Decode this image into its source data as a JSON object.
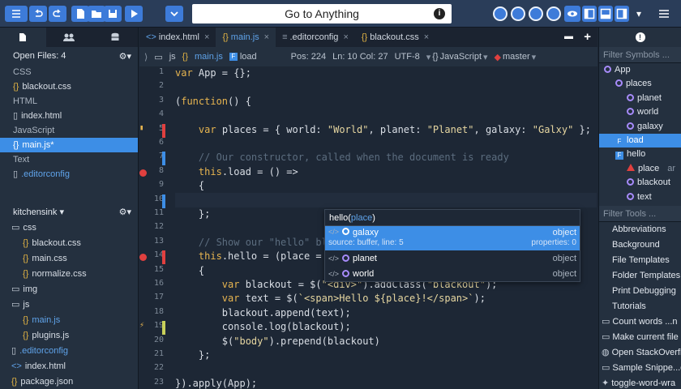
{
  "toolbar": {
    "goto_label": "Go to Anything",
    "icons": [
      "menu-icon",
      "back-icon",
      "forward-icon",
      "new-file-icon",
      "open-folder-icon",
      "save-icon",
      "run-icon",
      "dropdown-icon"
    ]
  },
  "left_pane": {
    "open_files_label": "Open Files: 4",
    "groups": [
      {
        "label": "CSS",
        "files": [
          {
            "icon": "{}",
            "name": "blackout.css"
          }
        ]
      },
      {
        "label": "HTML",
        "files": [
          {
            "icon": "▯",
            "name": "index.html"
          }
        ]
      },
      {
        "label": "JavaScript",
        "files": [
          {
            "icon": "{}",
            "name": "main.js*"
          }
        ]
      },
      {
        "label": "Text",
        "files": [
          {
            "icon": "▯",
            "name": ".editorconfig"
          }
        ]
      }
    ],
    "project_label": "kitchensink ▾",
    "tree": [
      {
        "indent": 1,
        "icon": "▭",
        "name": "css"
      },
      {
        "indent": 2,
        "icon": "{}",
        "name": "blackout.css"
      },
      {
        "indent": 2,
        "icon": "{}",
        "name": "main.css"
      },
      {
        "indent": 2,
        "icon": "{}",
        "name": "normalize.css"
      },
      {
        "indent": 1,
        "icon": "▭",
        "name": "img"
      },
      {
        "indent": 1,
        "icon": "▭",
        "name": "js"
      },
      {
        "indent": 2,
        "icon": "{}",
        "name": "main.js"
      },
      {
        "indent": 2,
        "icon": "{}",
        "name": "plugins.js"
      },
      {
        "indent": 1,
        "icon": "▯",
        "name": ".editorconfig"
      },
      {
        "indent": 1,
        "icon": "<>",
        "name": "index.html"
      },
      {
        "indent": 1,
        "icon": "{}",
        "name": "package.json"
      }
    ]
  },
  "tabs": [
    {
      "icon": "<>",
      "label": "index.html",
      "active": false
    },
    {
      "icon": "{}",
      "label": "main.js",
      "active": true
    },
    {
      "icon": "≡",
      "label": ".editorconfig",
      "active": false
    },
    {
      "icon": "{}",
      "label": "blackout.css",
      "active": false
    }
  ],
  "breadcrumb": {
    "folder": "js",
    "file": "main.js",
    "symbol": "load",
    "position": "Pos: 224",
    "line_col": "Ln: 10 Col: 27",
    "encoding": "UTF-8",
    "language": "JavaScript",
    "branch": "master"
  },
  "editor": {
    "lines": [
      {
        "n": "1",
        "html": "<span class=\"kw\">var</span> App = {};"
      },
      {
        "n": "2",
        "html": ""
      },
      {
        "n": "3",
        "html": "(<span class=\"kw\">function</span>() {"
      },
      {
        "n": "4",
        "html": ""
      },
      {
        "n": "5",
        "html": "    <span class=\"kw\">var</span> places = { world: <span class=\"str\">\"World\"</span>, planet: <span class=\"str\">\"Planet\"</span>, galaxy: <span class=\"str\">\"Galxy\"</span> };"
      },
      {
        "n": "6",
        "html": ""
      },
      {
        "n": "7",
        "html": "    <span class=\"cmt\">// Our constructor, called when the document is ready</span>"
      },
      {
        "n": "8",
        "html": "    <span class=\"kw\">this</span>.load = () =&gt;"
      },
      {
        "n": "9",
        "html": "    {"
      },
      {
        "n": "10",
        "html": "        <span class=\"kw\">this</span>.hello(places.);"
      },
      {
        "n": "11",
        "html": "    };"
      },
      {
        "n": "12",
        "html": ""
      },
      {
        "n": "13",
        "html": "    <span class=\"cmt\">// Show our \"hello\" bl</span>"
      },
      {
        "n": "14",
        "html": "    <span class=\"kw\">this</span>.hello = (place ="
      },
      {
        "n": "15",
        "html": "    {"
      },
      {
        "n": "16",
        "html": "        <span class=\"kw\">var</span> blackout = $(<span class=\"str\">\"&lt;div&gt;\"</span>).addClass(<span class=\"str\">\"blackout\"</span>);"
      },
      {
        "n": "17",
        "html": "        <span class=\"kw\">var</span> text = $(<span class=\"str\">`&lt;span&gt;Hello ${place}!&lt;/span&gt;`</span>);"
      },
      {
        "n": "18",
        "html": "        blackout.append(text);"
      },
      {
        "n": "19",
        "html": "        console.log(blackout);"
      },
      {
        "n": "20",
        "html": "        $(<span class=\"str\">\"body\"</span>).prepend(blackout)"
      },
      {
        "n": "21",
        "html": "    };"
      },
      {
        "n": "22",
        "html": ""
      },
      {
        "n": "23",
        "html": "}).apply(App);"
      }
    ]
  },
  "autocomplete": {
    "signature_fn": "hello(",
    "signature_param": "place",
    "signature_close": ")",
    "items": [
      {
        "name": "galaxy",
        "type": "object",
        "source": "source: buffer, line: 5",
        "props": "properties: 0",
        "selected": true
      },
      {
        "name": "planet",
        "type": "object",
        "selected": false
      },
      {
        "name": "world",
        "type": "object",
        "selected": false
      }
    ]
  },
  "right_pane": {
    "symbols_placeholder": "Filter Symbols ...",
    "symbols": [
      {
        "indent": 0,
        "kind": "circle",
        "name": "App"
      },
      {
        "indent": 1,
        "kind": "circle",
        "name": "places"
      },
      {
        "indent": 2,
        "kind": "circle",
        "name": "planet"
      },
      {
        "indent": 2,
        "kind": "circle",
        "name": "world"
      },
      {
        "indent": 2,
        "kind": "circle",
        "name": "galaxy"
      },
      {
        "indent": 1,
        "kind": "func",
        "name": "load",
        "selected": true
      },
      {
        "indent": 1,
        "kind": "func",
        "name": "hello"
      },
      {
        "indent": 2,
        "kind": "tri",
        "name": "place",
        "extra": "ar"
      },
      {
        "indent": 2,
        "kind": "circle",
        "name": "blackout"
      },
      {
        "indent": 2,
        "kind": "circle",
        "name": "text"
      }
    ],
    "tools_placeholder": "Filter Tools ...",
    "tools": [
      {
        "icon": "",
        "name": "Abbreviations"
      },
      {
        "icon": "",
        "name": "Background"
      },
      {
        "icon": "",
        "name": "File Templates"
      },
      {
        "icon": "",
        "name": "Folder Templates"
      },
      {
        "icon": "",
        "name": "Print Debugging"
      },
      {
        "icon": "",
        "name": "Tutorials"
      },
      {
        "icon": "▭",
        "name": "Count words ...n"
      },
      {
        "icon": "▭",
        "name": "Make current file"
      },
      {
        "icon": "◍",
        "name": "Open StackOverfl"
      },
      {
        "icon": "▭",
        "name": "Sample Snippe...o"
      },
      {
        "icon": "✦",
        "name": "toggle-word-wra"
      }
    ]
  },
  "colors": {
    "accent": "#3d8ee6",
    "toolbar": "#2a3d59",
    "editor_bg": "#1d2735",
    "keyword": "#e6b450"
  }
}
